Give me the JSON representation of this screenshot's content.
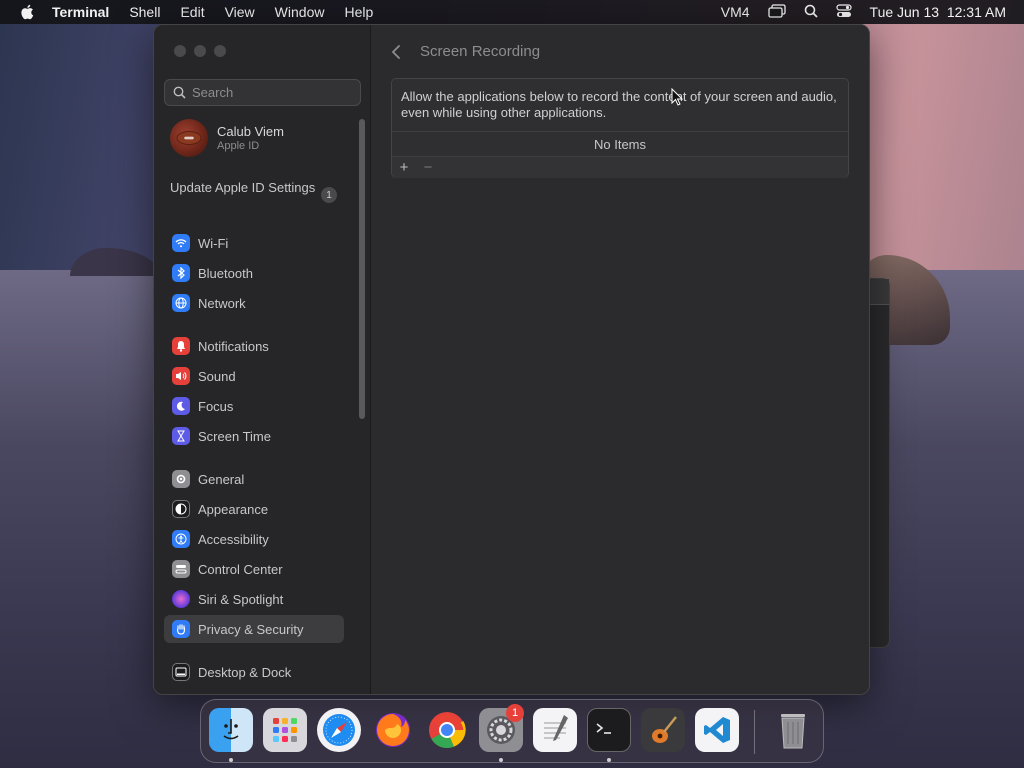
{
  "menubar": {
    "app_name": "Terminal",
    "menus": [
      "Shell",
      "Edit",
      "View",
      "Window",
      "Help"
    ],
    "status_label": "VM4",
    "datetime": "Tue Jun 13  12:31 AM"
  },
  "sidebar": {
    "search_placeholder": "Search",
    "account": {
      "name": "Calub Viem",
      "subtitle": "Apple ID"
    },
    "update": {
      "label": "Update Apple ID Settings",
      "count": "1"
    },
    "items": [
      {
        "label": "Wi-Fi",
        "color": "#2f7cf6"
      },
      {
        "label": "Bluetooth",
        "color": "#2f7cf6"
      },
      {
        "label": "Network",
        "color": "#2f7cf6"
      },
      {
        "label": "Notifications",
        "color": "#e5413a"
      },
      {
        "label": "Sound",
        "color": "#e5413a"
      },
      {
        "label": "Focus",
        "color": "#5e5ce6"
      },
      {
        "label": "Screen Time",
        "color": "#5e5ce6"
      },
      {
        "label": "General",
        "color": "#8e8e93"
      },
      {
        "label": "Appearance",
        "color": "#1c1c1e"
      },
      {
        "label": "Accessibility",
        "color": "#2f7cf6"
      },
      {
        "label": "Control Center",
        "color": "#8e8e93"
      },
      {
        "label": "Siri & Spotlight",
        "color": "#b04cd8"
      },
      {
        "label": "Privacy & Security",
        "color": "#2f7cf6"
      },
      {
        "label": "Desktop & Dock",
        "color": "#1c1c1e"
      }
    ],
    "selected": "Privacy & Security"
  },
  "content": {
    "title": "Screen Recording",
    "description": "Allow the applications below to record the content of your screen and audio, even while using other applications.",
    "empty_text": "No Items",
    "add_label": "+",
    "remove_label": "−"
  },
  "dock": {
    "apps": [
      "Finder",
      "Launchpad",
      "Safari",
      "Firefox",
      "Chrome",
      "System Settings",
      "TextEdit",
      "Terminal",
      "GarageBand",
      "Visual Studio Code"
    ],
    "settings_badge": "1"
  }
}
